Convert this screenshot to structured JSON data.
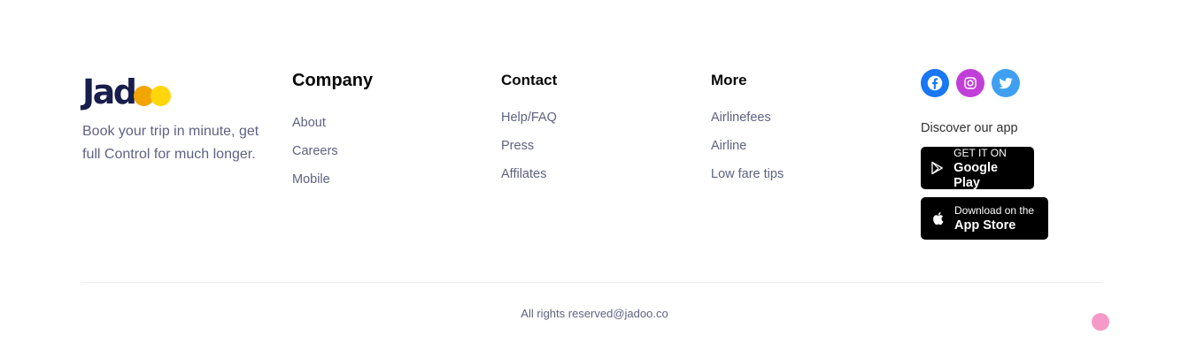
{
  "brand": {
    "logo_text": "Jad",
    "tagline": "Book your trip in minute, get full Control for much longer."
  },
  "company": {
    "title": "Company",
    "links": [
      "About",
      "Careers",
      "Mobile"
    ]
  },
  "contact": {
    "title": "Contact",
    "links": [
      "Help/FAQ",
      "Press",
      "Affilates"
    ]
  },
  "more": {
    "title": "More",
    "links": [
      "Airlinefees",
      "Airline",
      "Low fare tips"
    ]
  },
  "social": {
    "icons": [
      "facebook-icon",
      "instagram-icon",
      "twitter-icon"
    ]
  },
  "app": {
    "discover_label": "Discover our app",
    "google_play": {
      "small": "GET IT ON",
      "large": "Google Play"
    },
    "app_store": {
      "small": "Download on the",
      "large": "App Store"
    }
  },
  "footer": {
    "copyright": "All rights reserved@jadoo.co"
  },
  "colors": {
    "heading": "#181e4b",
    "text": "#5e6282",
    "accent": "#f1a501"
  }
}
